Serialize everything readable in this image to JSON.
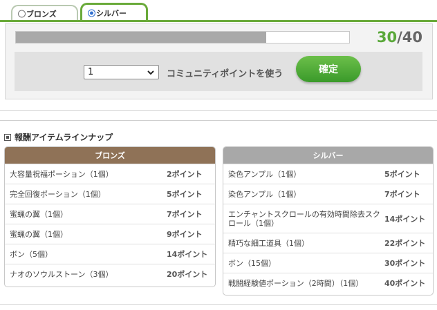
{
  "tabs": [
    {
      "label": "ブロンズ",
      "selected": false
    },
    {
      "label": "シルバー",
      "selected": true
    }
  ],
  "progress": {
    "current": "30",
    "separator": "/",
    "total": "40",
    "fraction": 0.75
  },
  "use": {
    "select_value": "1",
    "label": "コミュニティポイントを使う",
    "confirm_label": "確定"
  },
  "section_title": "報酬アイテムラインナップ",
  "bronze": {
    "header": "ブロンズ",
    "rows": [
      {
        "name": "大容量祝福ポーション（1個）",
        "points": "2ポイント"
      },
      {
        "name": "完全回復ポーション（1個）",
        "points": "5ポイント"
      },
      {
        "name": "蜜蝋の翼（1個）",
        "points": "7ポイント"
      },
      {
        "name": "蜜蝋の翼（1個）",
        "points": "9ポイント"
      },
      {
        "name": "ボン（5個）",
        "points": "14ポイント"
      },
      {
        "name": "ナオのソウルストーン（3個）",
        "points": "20ポイント"
      }
    ]
  },
  "silver": {
    "header": "シルバー",
    "rows": [
      {
        "name": "染色アンプル（1個）",
        "points": "5ポイント"
      },
      {
        "name": "染色アンプル（1個）",
        "points": "7ポイント"
      },
      {
        "name": "エンチャントスクロールの有効時間除去スクロール（1個）",
        "points": "14ポイント"
      },
      {
        "name": "精巧な細工道具（1個）",
        "points": "22ポイント"
      },
      {
        "name": "ボン（15個）",
        "points": "30ポイント"
      },
      {
        "name": "戦闘経験値ポーション（2時間）（1個）",
        "points": "40ポイント"
      }
    ]
  },
  "colors": {
    "accent": "#5aa83a",
    "bronze": "#8f7257",
    "silver": "#a8a8a8"
  }
}
